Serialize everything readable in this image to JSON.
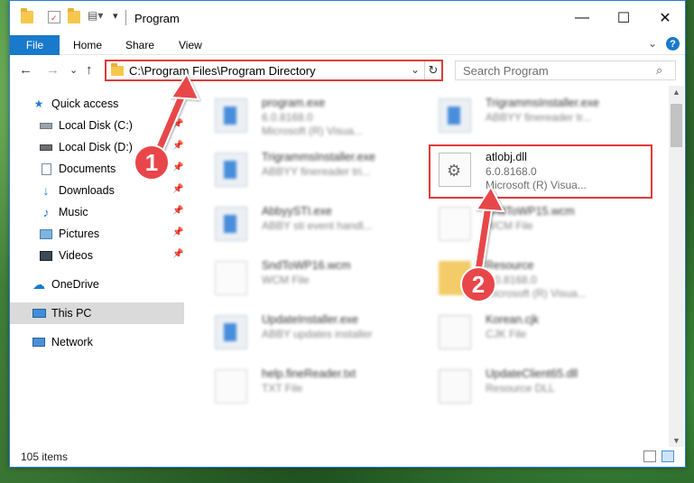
{
  "window": {
    "title": "Program",
    "accent": "#1979ca",
    "highlight_color": "#e03a3a"
  },
  "title_controls": {
    "minimize": "—",
    "maximize": "☐",
    "close": "✕"
  },
  "ribbon": {
    "tabs": [
      "File",
      "Home",
      "Share",
      "View"
    ]
  },
  "nav": {
    "back": "←",
    "forward": "→",
    "recent": "⌄",
    "up": "↑"
  },
  "address": {
    "path": "C:\\Program Files\\Program Directory",
    "refresh": "↻",
    "dropdown": "⌄"
  },
  "search": {
    "placeholder": "Search Program",
    "icon": "⌕"
  },
  "sidebar": {
    "items": [
      {
        "label": "Quick access",
        "icon": "star-icon",
        "pinned": false
      },
      {
        "label": "Local Disk (C:)",
        "icon": "drive-icon",
        "pinned": true
      },
      {
        "label": "Local Disk (D:)",
        "icon": "drive-icon",
        "pinned": true
      },
      {
        "label": "Documents",
        "icon": "documents-icon",
        "pinned": true
      },
      {
        "label": "Downloads",
        "icon": "download-icon",
        "pinned": true
      },
      {
        "label": "Music",
        "icon": "music-icon",
        "pinned": true
      },
      {
        "label": "Pictures",
        "icon": "pictures-icon",
        "pinned": true
      },
      {
        "label": "Videos",
        "icon": "videos-icon",
        "pinned": true
      },
      {
        "label": "OneDrive",
        "icon": "cloud-icon",
        "pinned": false
      },
      {
        "label": "This PC",
        "icon": "computer-icon",
        "pinned": false,
        "selected": true
      },
      {
        "label": "Network",
        "icon": "network-icon",
        "pinned": false
      }
    ]
  },
  "files": [
    {
      "name": "program.exe",
      "line2": "6.0.8168.0",
      "line3": "Microsoft (R) Visua...",
      "icon": "app-icon",
      "blurred": true
    },
    {
      "name": "TrigrammsInstaller.exe",
      "line2": "ABBYY finereader tr...",
      "line3": "",
      "icon": "app-icon",
      "blurred": true
    },
    {
      "name": "TrigrammsInstaller.exe",
      "line2": "ABBYY finereader tri...",
      "line3": "",
      "icon": "app-icon",
      "blurred": true
    },
    {
      "name": "atlobj.dll",
      "line2": "6.0.8168.0",
      "line3": "Microsoft (R) Visua...",
      "icon": "gear-file-icon",
      "blurred": false
    },
    {
      "name": "AbbyySTI.exe",
      "line2": "ABBY sti event handl...",
      "line3": "",
      "icon": "app-icon",
      "blurred": true
    },
    {
      "name": "SndToWP15.wcm",
      "line2": "WCM File",
      "line3": "",
      "icon": "document-icon",
      "blurred": true
    },
    {
      "name": "SndToWP16.wcm",
      "line2": "WCM File",
      "line3": "",
      "icon": "document-icon",
      "blurred": true
    },
    {
      "name": "Resource",
      "line2": "6.0.8168.0",
      "line3": "Microsoft (R) Visua...",
      "icon": "folder-icon",
      "blurred": true
    },
    {
      "name": "UpdateInstaller.exe",
      "line2": "ABBY updates installer",
      "line3": "",
      "icon": "app-icon",
      "blurred": true
    },
    {
      "name": "Korean.cjk",
      "line2": "CJK File",
      "line3": "",
      "icon": "gear-file-icon",
      "blurred": true
    },
    {
      "name": "help.fineReader.txt",
      "line2": "TXT File",
      "line3": "",
      "icon": "document-icon",
      "blurred": true
    },
    {
      "name": "UpdateClient65.dll",
      "line2": "Resource DLL",
      "line3": "",
      "icon": "gear-file-icon",
      "blurred": true
    }
  ],
  "annotations": [
    {
      "number": "1"
    },
    {
      "number": "2"
    }
  ],
  "status": {
    "item_count": "105 items"
  }
}
